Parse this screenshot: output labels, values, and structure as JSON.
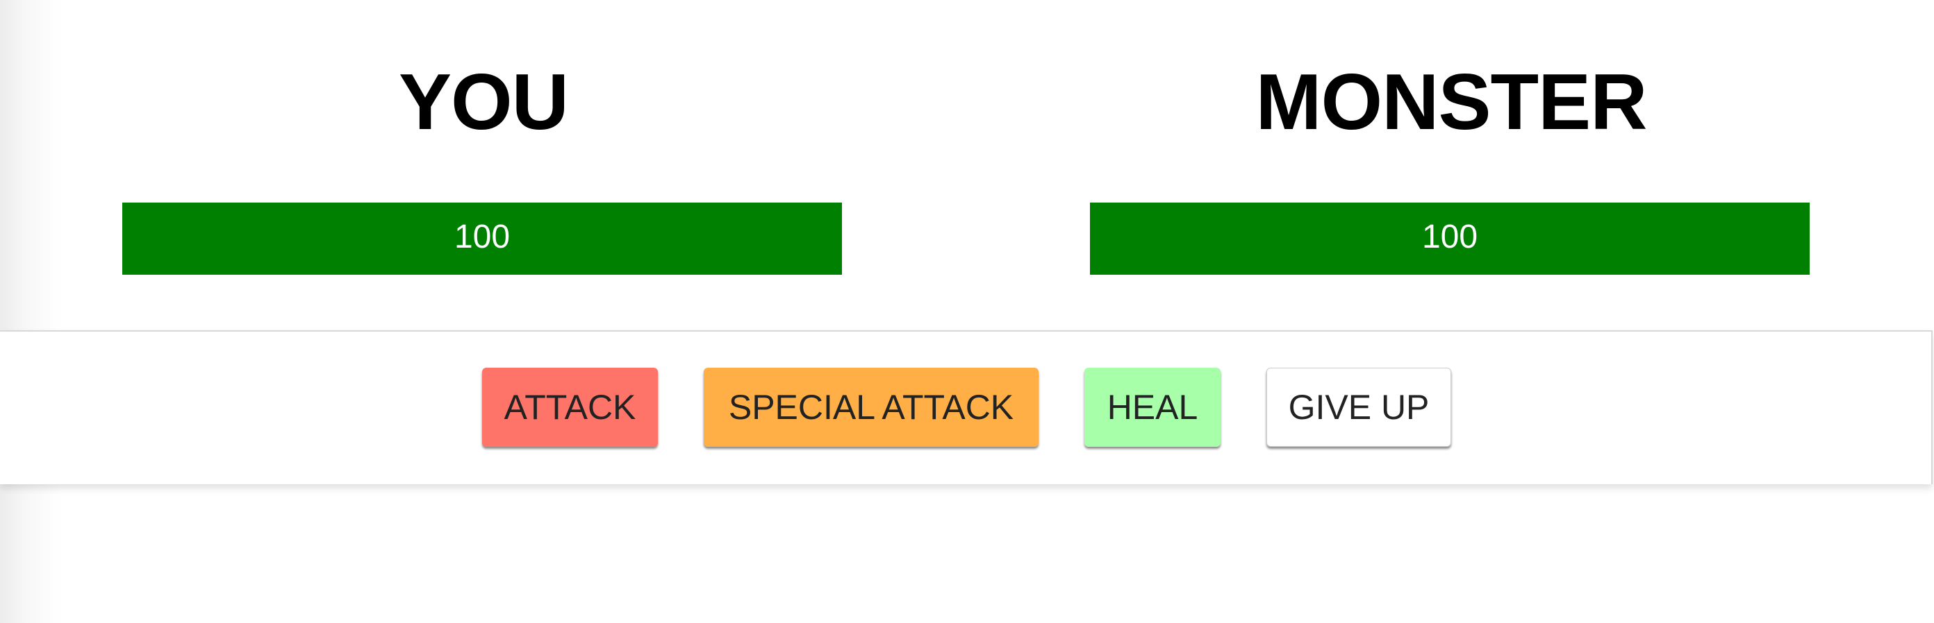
{
  "player": {
    "title": "YOU",
    "health": 100,
    "health_label": "100"
  },
  "monster": {
    "title": "MONSTER",
    "health": 100,
    "health_label": "100"
  },
  "controls": {
    "attack_label": "ATTACK",
    "special_attack_label": "SPECIAL ATTACK",
    "heal_label": "HEAL",
    "give_up_label": "GIVE UP"
  },
  "colors": {
    "health_bar": "#008000",
    "attack_button": "#ff7468",
    "special_attack_button": "#ffaf45",
    "heal_button": "#a8ffaa",
    "give_up_button": "#ffffff"
  }
}
